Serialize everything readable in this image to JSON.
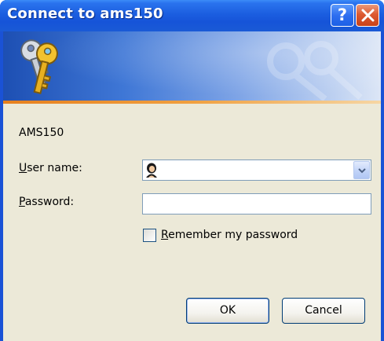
{
  "window": {
    "title": "Connect to ams150",
    "help_glyph": "?"
  },
  "banner": {
    "icon": "keys-icon"
  },
  "dialog": {
    "server_name": "AMS150",
    "username_label_accel": "U",
    "username_label_rest": "ser name:",
    "username_value": "",
    "password_label_accel": "P",
    "password_label_rest": "assword:",
    "password_value": "",
    "remember_checked": false,
    "remember_label_accel": "R",
    "remember_label_rest": "emember my password"
  },
  "buttons": {
    "ok": "OK",
    "cancel": "Cancel"
  },
  "colors": {
    "titlebar": "#1b5ee0",
    "dialog_bg": "#ece9d8",
    "accent_stripe": "#e6801e",
    "close_button": "#dd5a31"
  }
}
